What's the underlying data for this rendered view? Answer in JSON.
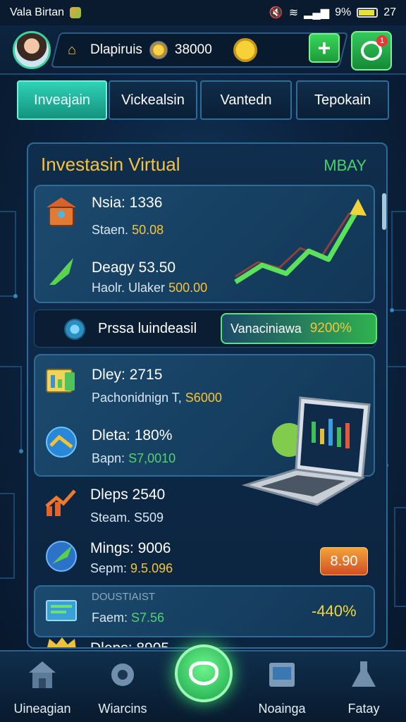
{
  "status_bar": {
    "carrier": "Vala Birtan",
    "battery": "9%",
    "time": "27",
    "battery_level": 0.9
  },
  "header": {
    "player_name": "Dlapiruis",
    "coins": "38000",
    "add_label": "+",
    "chat_badge": "1"
  },
  "tabs": [
    {
      "label": "Inveajain",
      "active": true
    },
    {
      "label": "Vickealsin",
      "active": false
    },
    {
      "label": "Vantedn",
      "active": false
    },
    {
      "label": "Tepokain",
      "active": false
    }
  ],
  "panel": {
    "title": "Investasin Virtual",
    "tag": "MBAY",
    "top_card": [
      {
        "title": "Nsia: 1336",
        "sub_prefix": "Staen.",
        "sub_value": "50.08",
        "icon": "house-chest-icon"
      },
      {
        "title": "Deagy 53.50",
        "sub_prefix": "Haolr. Ulaker",
        "sub_value": "500.00",
        "icon": "rocket-icon"
      }
    ],
    "summary": {
      "label": "Prssa luindeasil",
      "pill_label": "Vanaciniawa",
      "pill_value": "9200%"
    },
    "middle_card": [
      {
        "title": "Dley: 2715",
        "sub_prefix": "Pachonidnign T,",
        "sub_value": "S6000",
        "icon": "chart-board-icon"
      },
      {
        "title": "Dleta: 180%",
        "sub_prefix": "Bapn:",
        "sub_value": "S7,0010",
        "icon": "shield-arrow-icon"
      }
    ],
    "list": [
      {
        "title": "Dleps 2540",
        "sub": "Steam. S509",
        "icon": "trend-up-icon"
      },
      {
        "title": "Mings: 9006",
        "sub_prefix": "Sepm:",
        "sub_value": "9.5.096",
        "badge": "8.90",
        "icon": "leaf-globe-icon"
      }
    ],
    "bottom_card": {
      "title": "DOUSTIAIST",
      "sub_prefix": "Faem:",
      "sub_value": "S7.56",
      "change": "-440%"
    },
    "partial_row": {
      "title": "Dleps: 8905"
    }
  },
  "nav": [
    {
      "label": "Uineagian",
      "icon": "house-icon"
    },
    {
      "label": "Wiarcins",
      "icon": "gear-icon"
    },
    {
      "label": "",
      "icon": "center-action-icon"
    },
    {
      "label": "Noainga",
      "icon": "window-icon"
    },
    {
      "label": "Fatay",
      "icon": "flask-icon"
    }
  ]
}
